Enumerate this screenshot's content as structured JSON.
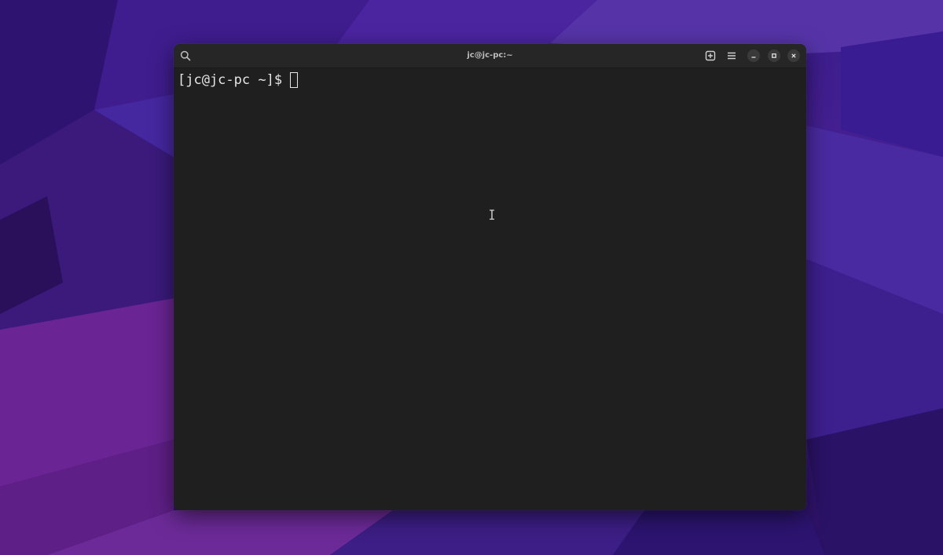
{
  "window": {
    "title": "jc@jc-pc:~"
  },
  "terminal": {
    "prompt": "[jc@jc-pc ~]$"
  },
  "icons": {
    "search": "search-icon",
    "new_tab": "new-tab-icon",
    "menu": "hamburger-menu-icon",
    "minimize": "minimize-icon",
    "maximize": "maximize-icon",
    "close": "close-icon",
    "mouse_cursor": "text-cursor-icon"
  },
  "colors": {
    "terminal_bg": "#1f1f1f",
    "titlebar_bg": "#262626",
    "text": "#e6e6e6",
    "wallpaper_primary": "#4a2196"
  }
}
